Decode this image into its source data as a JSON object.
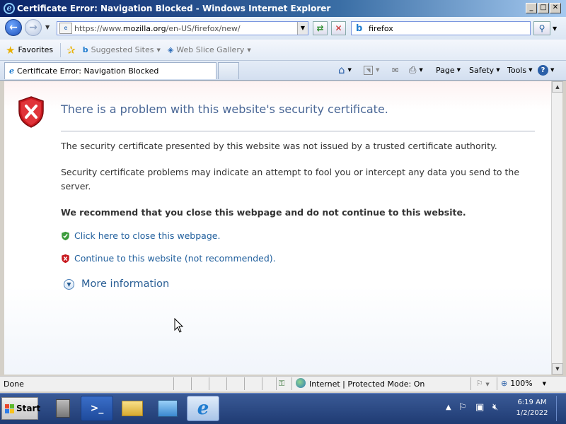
{
  "window": {
    "title": "Certificate Error: Navigation Blocked - Windows Internet Explorer"
  },
  "address": {
    "url_prefix": "https://www.",
    "url_domain": "mozilla.org",
    "url_path": "/en-US/firefox/new/"
  },
  "search": {
    "value": "firefox"
  },
  "favorites": {
    "label": "Favorites",
    "items": [
      {
        "label": "Suggested Sites"
      },
      {
        "label": "Web Slice Gallery"
      }
    ]
  },
  "tab": {
    "label": "Certificate Error: Navigation Blocked"
  },
  "commandbar": {
    "page": "Page",
    "safety": "Safety",
    "tools": "Tools"
  },
  "content": {
    "heading": "There is a problem with this website's security certificate.",
    "p1": "The security certificate presented by this website was not issued by a trusted certificate authority.",
    "p2": "Security certificate problems may indicate an attempt to fool you or intercept any data you send to the server.",
    "recommend": "We recommend that you close this webpage and do not continue to this website.",
    "close_link": "Click here to close this webpage.",
    "continue_link": "Continue to this website (not recommended).",
    "more_info": "More information"
  },
  "statusbar": {
    "left": "Done",
    "zone": "Internet | Protected Mode: On",
    "zoom": "100%"
  },
  "taskbar": {
    "start": "Start",
    "time": "6:19 AM",
    "date": "1/2/2022"
  },
  "colors": {
    "title_bar": "#0a246a",
    "link": "#1f5e9c",
    "heading": "#4a6796",
    "shield_red": "#c8181e",
    "shield_green": "#3c9c3c"
  }
}
